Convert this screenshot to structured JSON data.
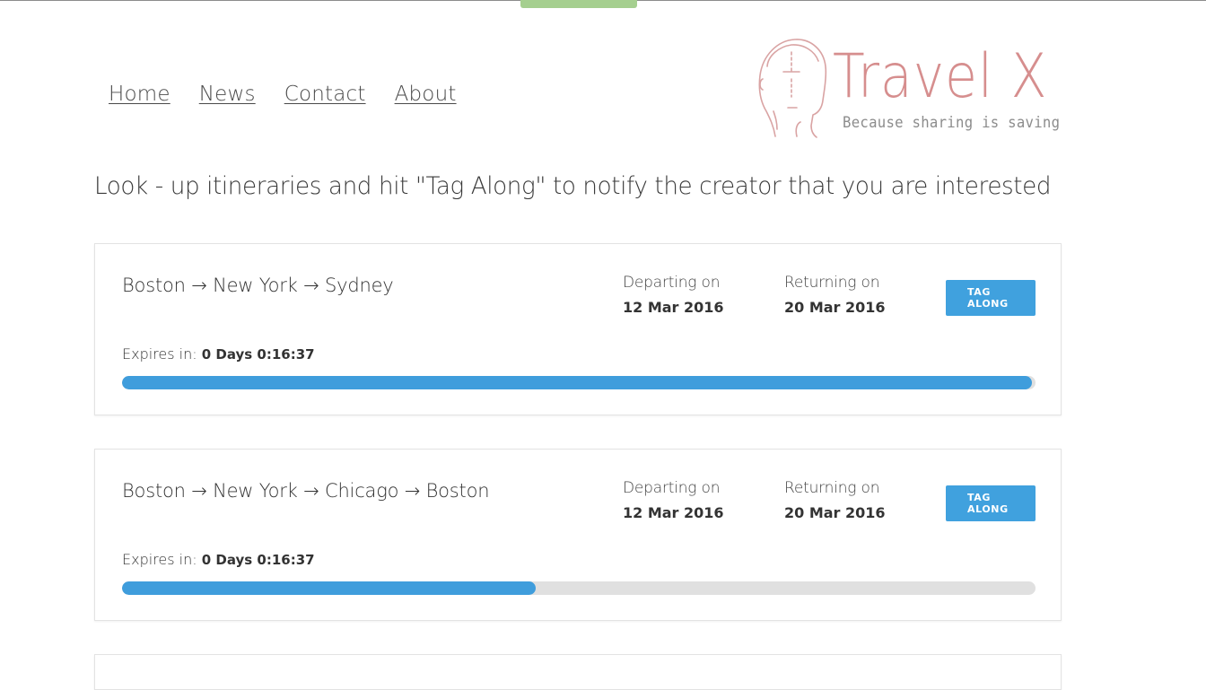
{
  "nav": {
    "items": [
      "Home",
      "News",
      "Contact",
      "About"
    ]
  },
  "logo": {
    "title": "Travel X",
    "tagline": "Because sharing is saving",
    "icon": "head-outline-icon",
    "color": "#d68e8e"
  },
  "headline": "Look - up itineraries and hit \"Tag Along\" to notify the creator that you are interested",
  "itineraries": [
    {
      "route": "Boston → New York → Sydney",
      "departing_label": "Departing on",
      "departing_date": "12 Mar 2016",
      "returning_label": "Returning on",
      "returning_date": "20 Mar 2016",
      "button_label": "TAG ALONG",
      "expires_label": "Expires in:",
      "expires_value": "0 Days 0:16:37",
      "progress": 0.996
    },
    {
      "route": "Boston → New York → Chicago → Boston",
      "departing_label": "Departing on",
      "departing_date": "12 Mar 2016",
      "returning_label": "Returning on",
      "returning_date": "20 Mar 2016",
      "button_label": "TAG ALONG",
      "expires_label": "Expires in:",
      "expires_value": "0 Days 0:16:37",
      "progress": 0.453
    }
  ],
  "colors": {
    "accent": "#40a1de",
    "progress": "#3f9ddc",
    "track": "#e0e0e0",
    "top_tab": "#a5cf8f"
  }
}
